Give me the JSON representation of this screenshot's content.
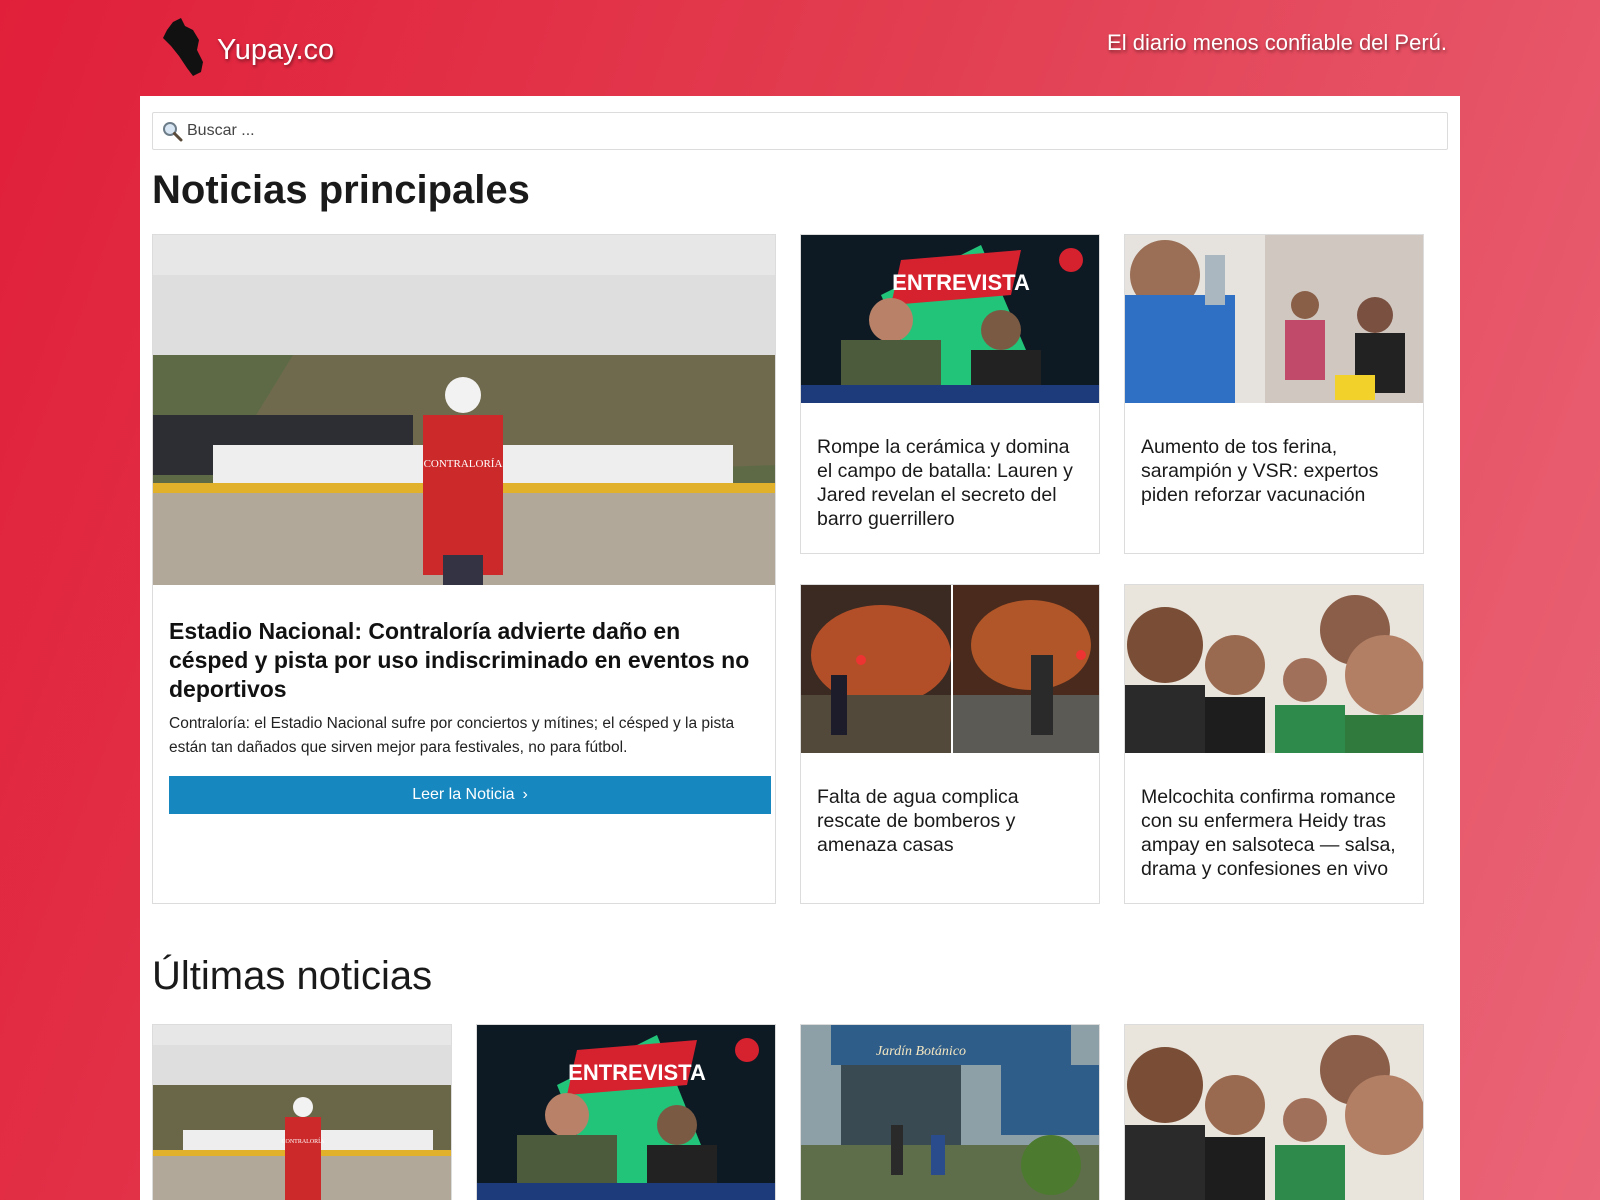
{
  "header": {
    "logo_text": "Yupay.co",
    "tagline": "El diario menos confiable del Perú."
  },
  "search": {
    "placeholder": "Buscar ..."
  },
  "main_section": {
    "title": "Noticias principales",
    "featured": {
      "image_caption": "CONTRALORÍA",
      "title": "Estadio Nacional: Contraloría advierte daño en césped y pista por uso indiscriminado en eventos no deportivos",
      "description": "Contraloría: el Estadio Nacional sufre por conciertos y mítines; el césped y la pista están tan dañados que sirven mejor para festivales, no para fútbol.",
      "button_label": "Leer la Noticia"
    },
    "cards": [
      {
        "title": "Rompe la cerámica y domina el campo de batalla: Lauren y Jared revelan el secreto del barro guerrillero",
        "image_text": "ENTREVISTA"
      },
      {
        "title": "Aumento de tos ferina, sarampión y VSR: expertos piden reforzar vacunación"
      },
      {
        "title": "Falta de agua complica rescate de bomberos y amenaza casas"
      },
      {
        "title": "Melcochita confirma romance con su enfermera Heidy tras ampay en salsoteca — salsa, drama y confesiones en vivo"
      }
    ]
  },
  "latest_section": {
    "title": "Últimas noticias",
    "images": [
      {
        "caption": "CONTRALORÍA"
      },
      {
        "caption": "ENTREVISTA"
      },
      {
        "caption": "Jardín Botánico"
      },
      {
        "caption": ""
      }
    ]
  },
  "colors": {
    "brand_red": "#e11f3a",
    "button_blue": "#1687bf"
  },
  "icons": [
    "peru-map-icon",
    "search-icon",
    "chevron-right-icon"
  ]
}
